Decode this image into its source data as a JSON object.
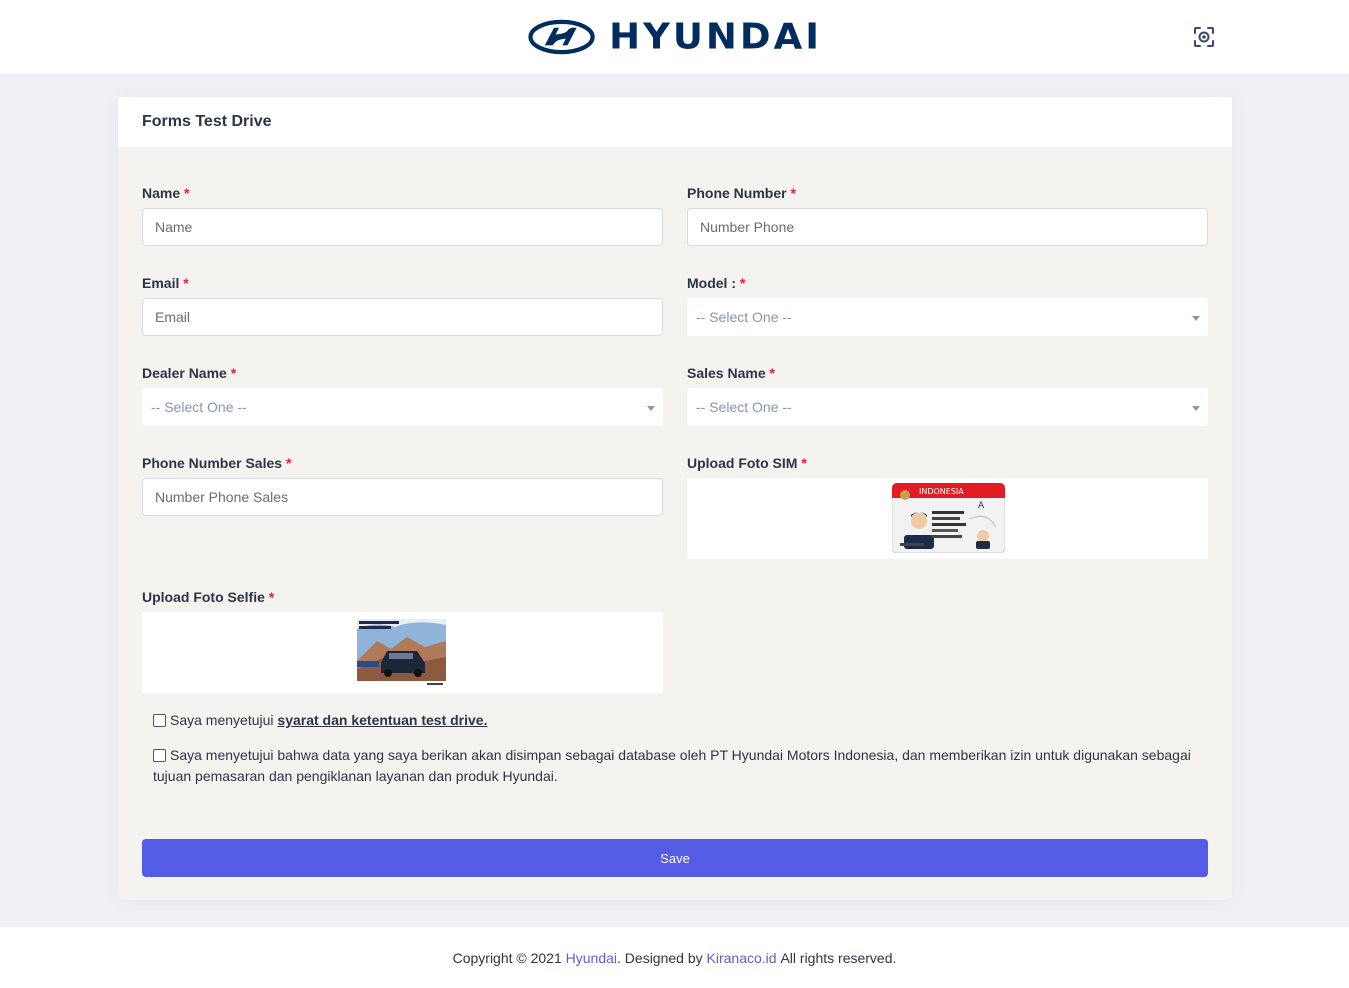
{
  "header": {
    "brand": "HYUNDAI",
    "scan_icon": "scan-icon"
  },
  "card": {
    "title": "Forms Test Drive"
  },
  "form": {
    "name": {
      "label": "Name",
      "required": "*",
      "placeholder": "Name",
      "value": ""
    },
    "phone": {
      "label": "Phone Number",
      "required": "*",
      "placeholder": "Number Phone",
      "value": ""
    },
    "email": {
      "label": "Email",
      "required": "*",
      "placeholder": "Email",
      "value": ""
    },
    "model": {
      "label": "Model :",
      "required": "*",
      "selected": "-- Select One --"
    },
    "dealer": {
      "label": "Dealer Name",
      "required": "*",
      "selected": "-- Select One --"
    },
    "sales": {
      "label": "Sales Name",
      "required": "*",
      "selected": "-- Select One --"
    },
    "phone_sales": {
      "label": "Phone Number Sales",
      "required": "*",
      "placeholder": "Number Phone Sales",
      "value": ""
    },
    "sim": {
      "label": "Upload Foto SIM",
      "required": "*",
      "card_country": "INDONESIA",
      "card_class": "A"
    },
    "selfie": {
      "label": "Upload Foto Selfie",
      "required": "*"
    },
    "agree_terms": {
      "prefix": "Saya menyetujui ",
      "link": "syarat dan ketentuan test drive."
    },
    "agree_data": {
      "text": "Saya menyetujui bahwa data yang saya berikan akan disimpan sebagai database oleh PT Hyundai Motors Indonesia, dan memberikan izin untuk digunakan sebagai tujuan pemasaran dan pengiklanan layanan dan produk Hyundai."
    },
    "save_label": "Save"
  },
  "footer": {
    "prefix": "Copyright © 2021 ",
    "brand_link": "Hyundai",
    "middle": ". Designed by ",
    "designer_link": "Kiranaco.id",
    "suffix": " All rights reserved."
  },
  "colors": {
    "brand_navy": "#002c5f",
    "primary_button": "#545be4",
    "required_star": "#e11d48",
    "link": "#5b5fd6"
  }
}
